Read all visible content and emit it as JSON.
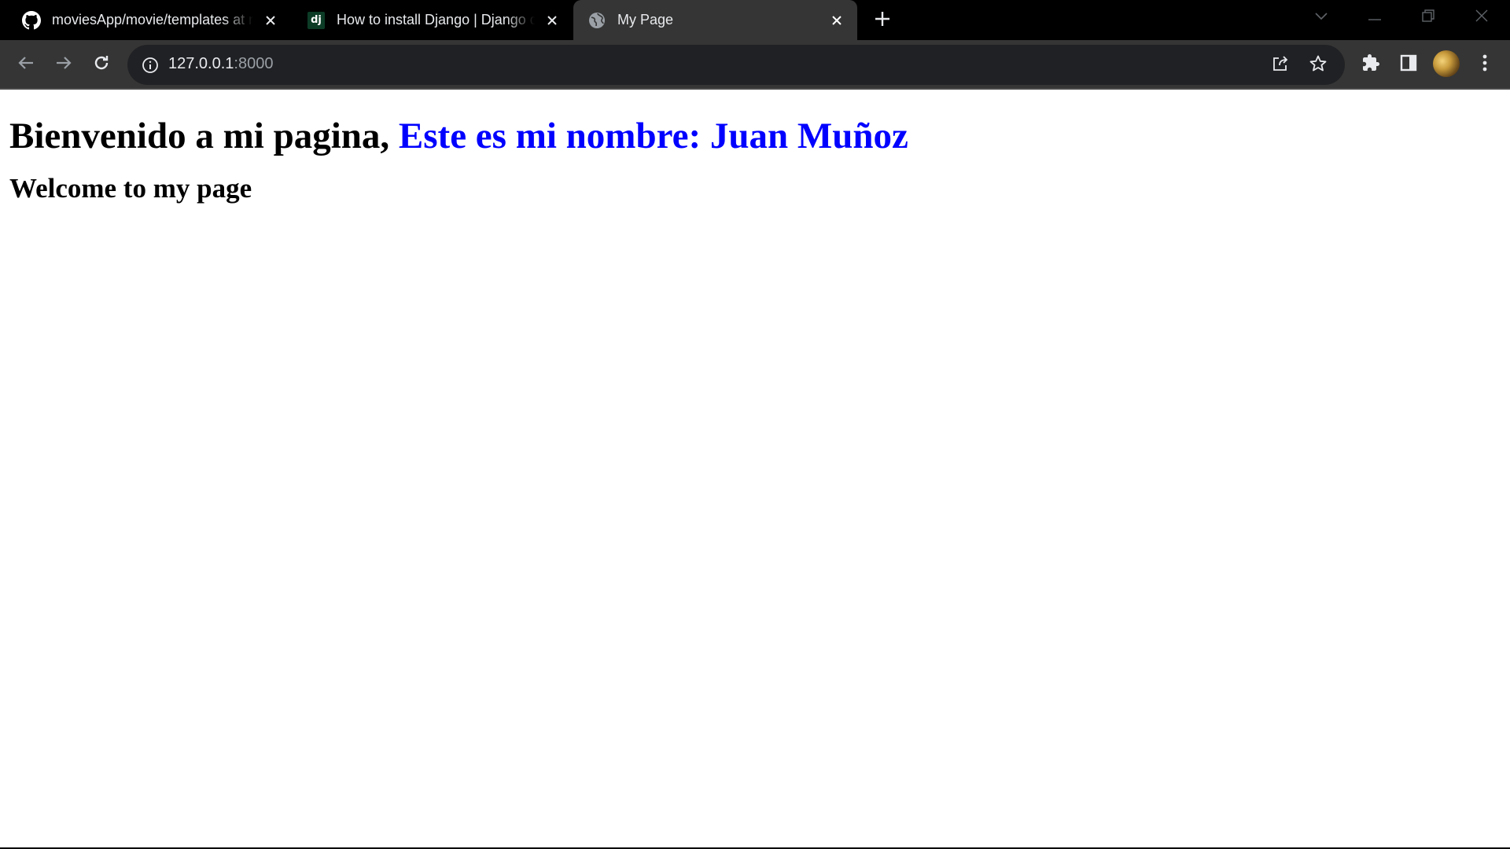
{
  "browser": {
    "tabs": [
      {
        "title": "moviesApp/movie/templates at main · juanmunoz/moviesApp",
        "favicon": "github-icon",
        "active": false
      },
      {
        "title": "How to install Django | Django documentation",
        "favicon": "django-icon",
        "favicon_text": "dj",
        "active": false
      },
      {
        "title": "My Page",
        "favicon": "globe-icon",
        "active": true
      }
    ],
    "address_bar": {
      "host": "127.0.0.1",
      "port": ":8000"
    }
  },
  "page": {
    "heading_prefix": "Bienvenido a mi pagina, ",
    "heading_name": "Este es mi nombre: Juan Muñoz",
    "subheading": "Welcome to my page"
  },
  "colors": {
    "tabstrip_bg": "#000000",
    "toolbar_bg": "#353535",
    "omnibox_bg": "#202124",
    "heading_name_color": "#0000ff"
  }
}
